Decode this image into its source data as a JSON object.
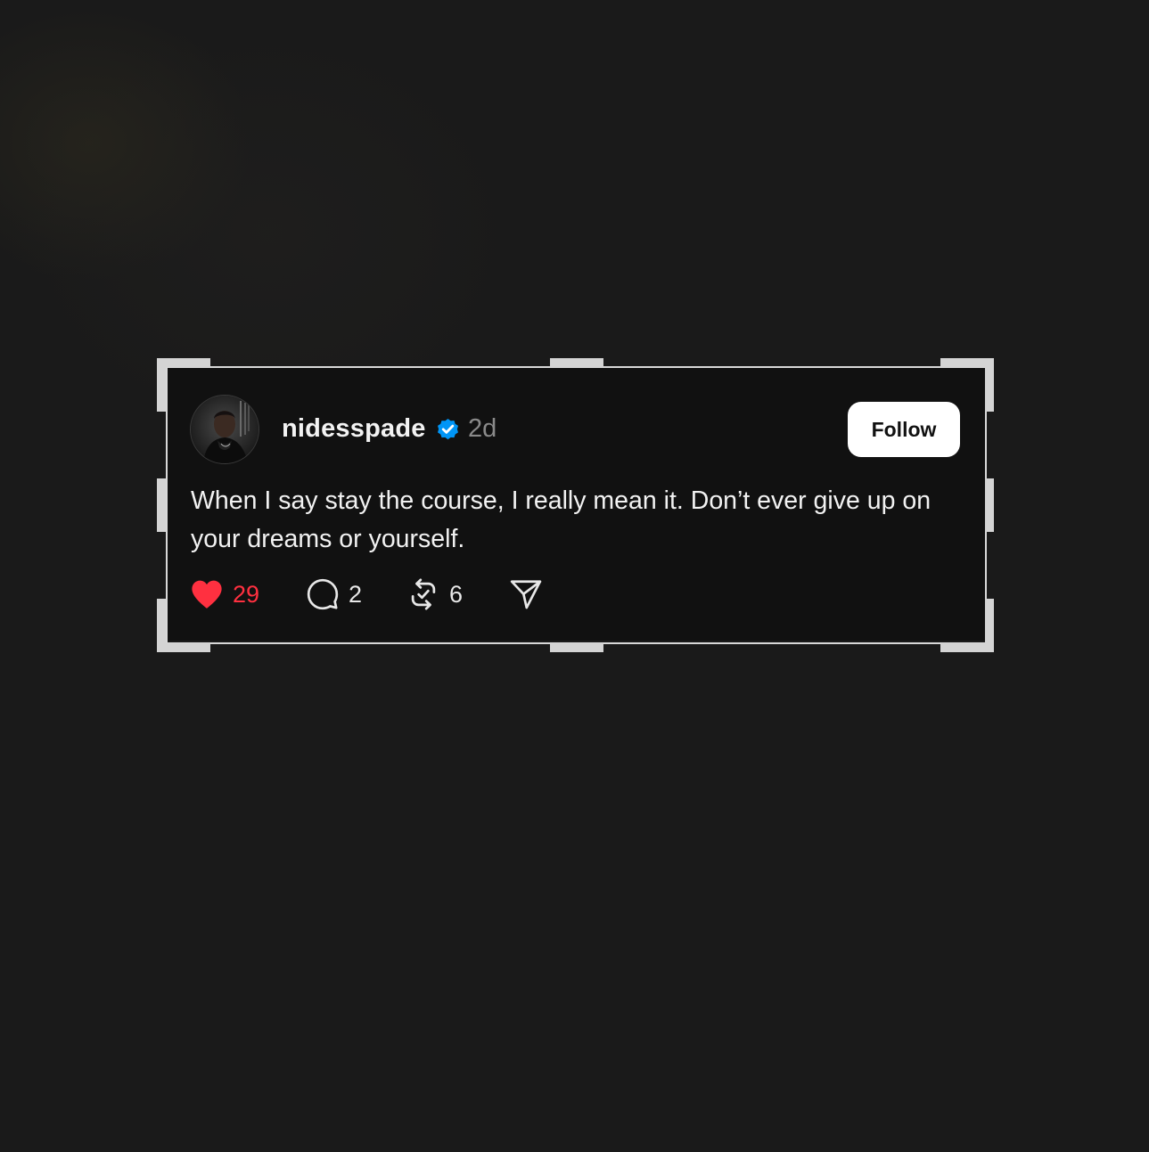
{
  "post": {
    "username": "nidesspade",
    "verified_icon": "verified-badge-icon",
    "timestamp": "2d",
    "follow_label": "Follow",
    "text": "When I say stay the course, I really mean it. Don’t ever give up on your dreams or yourself.",
    "likes": "29",
    "replies": "2",
    "reposts": "6"
  },
  "icons": {
    "like": "heart-icon",
    "reply": "comment-bubble-icon",
    "repost": "repost-icon",
    "share": "send-icon"
  },
  "colors": {
    "background": "#1a1a1a",
    "card": "#111111",
    "like_accent": "#ff3040",
    "verified_blue": "#0095f6",
    "frame": "#d9d9d9"
  }
}
